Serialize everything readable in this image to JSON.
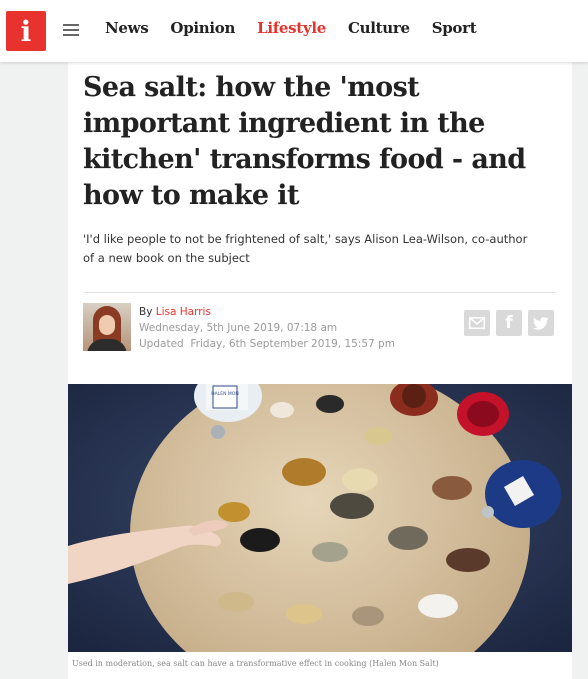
{
  "logo": {
    "letter": "i"
  },
  "nav": {
    "items": [
      {
        "label": "News",
        "active": false
      },
      {
        "label": "Opinion",
        "active": false
      },
      {
        "label": "Lifestyle",
        "active": true
      },
      {
        "label": "Culture",
        "active": false
      },
      {
        "label": "Sport",
        "active": false
      }
    ]
  },
  "article": {
    "headline": "Sea salt: how the 'most important ingredient in the kitchen' transforms food - and how to make it",
    "standfirst": "'I'd like people to not be frightened of salt,' says Alison Lea-Wilson, co-author of a new book on the subject",
    "byline": {
      "by": "By",
      "author": "Lisa Harris",
      "published": "Wednesday, 5th June 2019, 07:18 am",
      "updated_label": "Updated",
      "updated": "Friday, 6th September 2019, 15:57 pm"
    },
    "share": {
      "email_icon": "email-icon",
      "facebook_icon": "facebook-icon",
      "twitter_icon": "twitter-icon"
    },
    "photo": {
      "jar_label": "HALEN MON",
      "caption": "Used in moderation, sea salt can have a transformative effect in cooking (Halen Mon Salt)"
    }
  },
  "colors": {
    "accent": "#e8322d",
    "background": "#f0f2f2"
  }
}
